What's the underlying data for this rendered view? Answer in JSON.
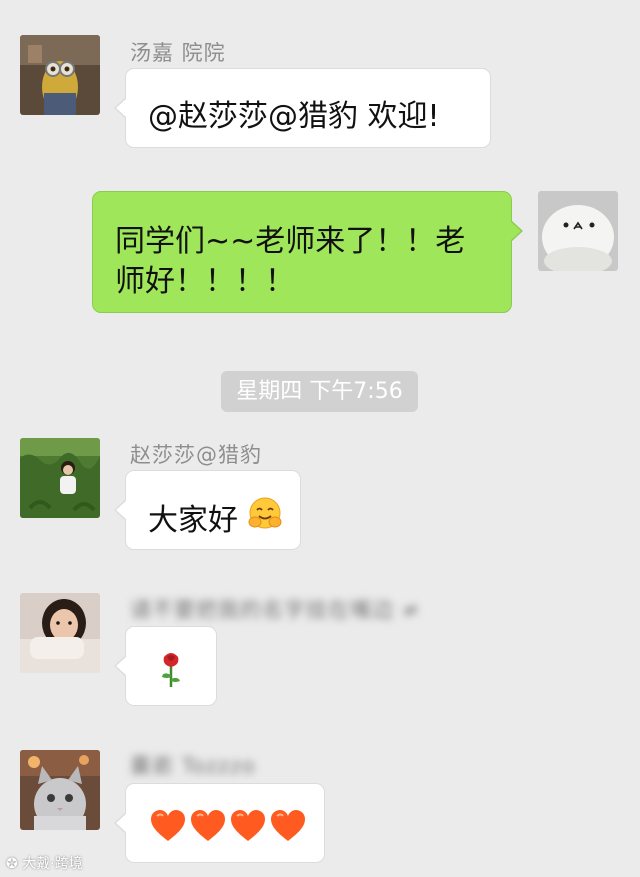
{
  "messages": [
    {
      "sender": "汤嘉 院院",
      "text": "@赵莎莎@猎豹 欢迎!"
    },
    {
      "text_line1": "同学们~~老师来了！！老",
      "text_line2": "师好！！！！"
    },
    {
      "sender": "赵莎莎@猎豹",
      "text": "大家好",
      "emoji": "hugging-face"
    },
    {
      "sender": "请不要把我的名字挂在嘴边 ≠",
      "emoji": "rose"
    },
    {
      "sender": "囊嵛 Tozzzo",
      "emoji": "hearts"
    }
  ],
  "timestamp": "星期四 下午7:56",
  "watermark": "大戴·跨境",
  "colors": {
    "background": "#ebebeb",
    "bubble_incoming": "#ffffff",
    "bubble_outgoing": "#9fe65a",
    "sender_name": "#8e8e8e",
    "timestamp_bg": "#d1d1d1"
  }
}
